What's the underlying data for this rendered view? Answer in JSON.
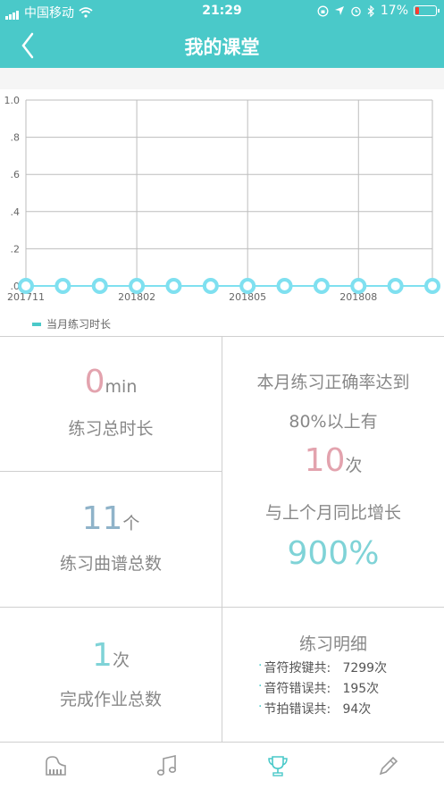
{
  "status_bar": {
    "carrier": "中国移动",
    "time": "21:29",
    "battery": "17%",
    "battery_level": 0.17
  },
  "nav": {
    "title": "我的课堂"
  },
  "chart_data": {
    "type": "line",
    "x": [
      "201711",
      "201712",
      "201801",
      "201802",
      "201803",
      "201804",
      "201805",
      "201806",
      "201807",
      "201808",
      "201809",
      "201810"
    ],
    "x_tick_labels": [
      "201711",
      "201802",
      "201805",
      "201808"
    ],
    "series": [
      {
        "name": "当月练习时长",
        "values": [
          0,
          0,
          0,
          0,
          0,
          0,
          0,
          0,
          0,
          0,
          0,
          0
        ]
      }
    ],
    "y_tick_labels": [
      "1.0",
      ".8",
      ".6",
      ".4",
      ".2",
      ".0"
    ],
    "ylim": [
      0,
      1.0
    ],
    "grid": true,
    "legend": "bottom-left",
    "series_color": "#7fe0f0",
    "legend_color": "#4ac9c9"
  },
  "stats": {
    "total_time": {
      "value": "0",
      "unit": "min",
      "label": "练习总时长"
    },
    "total_scores": {
      "value": "11",
      "unit": "个",
      "label": "练习曲谱总数"
    },
    "homework": {
      "value": "1",
      "unit": "次",
      "label": "完成作业总数"
    },
    "accuracy": {
      "line1": "本月练习正确率达到",
      "line2": "80%以上有",
      "value": "10",
      "unit": "次",
      "line3": "与上个月同比增长",
      "growth": "900%"
    },
    "details": {
      "title": "练习明细",
      "rows": [
        {
          "name": "音符按键共:",
          "value": "7299次"
        },
        {
          "name": "音符错误共:",
          "value": "195次"
        },
        {
          "name": "节拍错误共:",
          "value": "94次"
        }
      ]
    }
  },
  "tabs": [
    {
      "icon": "piano-icon"
    },
    {
      "icon": "music-note-icon"
    },
    {
      "icon": "trophy-icon",
      "active": true
    },
    {
      "icon": "pencil-icon"
    }
  ],
  "colors": {
    "accent": "#4ac9c9",
    "pink": "#e3a3ae",
    "blue": "#8fb3c9",
    "teal": "#7fd3d7"
  }
}
